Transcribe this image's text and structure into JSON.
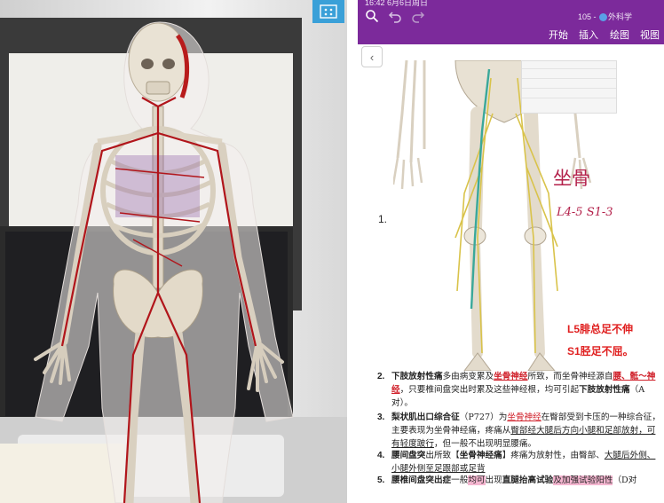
{
  "status": {
    "time": "16:42 6月6日周日"
  },
  "toolbar": {
    "page_info_prefix": "105 - ",
    "page_info_section": "外科学"
  },
  "tabs": [
    {
      "label": "开始"
    },
    {
      "label": "插入"
    },
    {
      "label": "绘图"
    },
    {
      "label": "视图"
    }
  ],
  "note": {
    "first_item_number": "1.",
    "handwriting": {
      "line1": "坐骨",
      "line2": "L4-5 S1-3"
    },
    "red_notes": [
      "L5腓总足不伸",
      "S1胫足不屈。"
    ],
    "items": [
      {
        "number": "2.",
        "segments": [
          {
            "text": "下肢放射性痛",
            "bold": true
          },
          {
            "text": "多由病变累及"
          },
          {
            "text": "坐骨神经",
            "bold": true,
            "red": true,
            "underline": true
          },
          {
            "text": "所致，而坐骨神经源自"
          },
          {
            "text": "腰、骶～神经",
            "bold": true,
            "red": true,
            "underline": true
          },
          {
            "text": "，只要椎间盘突出时累及这些神经根，均可引起"
          },
          {
            "text": "下肢放射性痛",
            "bold": true
          },
          {
            "text": "（A对）。"
          }
        ]
      },
      {
        "number": "3.",
        "segments": [
          {
            "text": "梨状肌出口综合征",
            "bold": true
          },
          {
            "text": "（P727）为"
          },
          {
            "text": "坐骨神经",
            "red": true,
            "underline": true
          },
          {
            "text": "在臀部受到卡压的一种综合征，主要表现为坐骨神经痛，疼痛从"
          },
          {
            "text": "臀部经大腿后方向小腿和足部放射，可有轻度跛行",
            "underline": true
          },
          {
            "text": "，但一般不出现明显腰痛。"
          }
        ]
      },
      {
        "number": "4.",
        "segments": [
          {
            "text": "腰间盘突",
            "bold": true
          },
          {
            "text": "出所致【"
          },
          {
            "text": "坐骨神经痛",
            "bold": true
          },
          {
            "text": "】疼痛为放射性，由臀部、"
          },
          {
            "text": "大腿后外侧、小腿外侧至足跟部或足背",
            "underline": true
          }
        ]
      },
      {
        "number": "5.",
        "segments": [
          {
            "text": "腰椎间盘突出症",
            "bold": true
          },
          {
            "text": "一般"
          },
          {
            "text": "均可",
            "highlight": true
          },
          {
            "text": "出现"
          },
          {
            "text": "直腿抬高试验",
            "bold": true
          },
          {
            "text": "及加强试验阳性",
            "highlight": true
          },
          {
            "text": "（D对"
          }
        ]
      }
    ]
  },
  "colors": {
    "ribbon": "#7c2a9b",
    "ar_button": "#3aa0d8",
    "red_note": "#e02020",
    "handwriting": "#b3204a",
    "highlight": "#f4b6d0"
  },
  "icons": {
    "search": "search-icon",
    "undo": "undo-icon",
    "redo": "redo-icon",
    "back": "chevron-left-icon",
    "ar_mode": "ar-scan-icon"
  }
}
